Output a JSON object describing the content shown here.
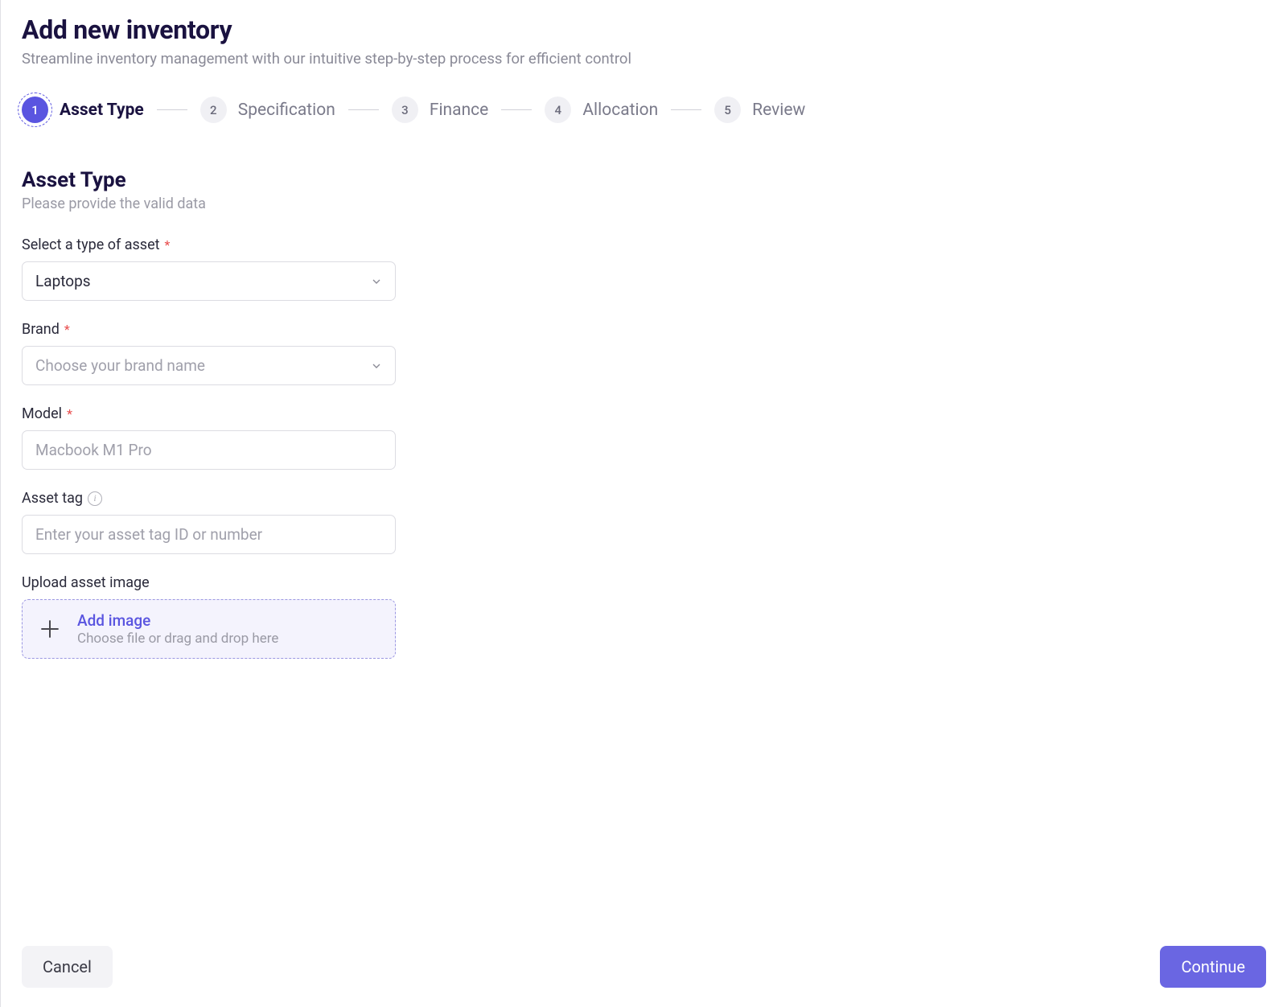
{
  "header": {
    "title": "Add new inventory",
    "subtitle": "Streamline inventory management with our intuitive step-by-step process for efficient control"
  },
  "stepper": {
    "steps": [
      {
        "num": "1",
        "label": "Asset Type",
        "active": true
      },
      {
        "num": "2",
        "label": "Specification",
        "active": false
      },
      {
        "num": "3",
        "label": "Finance",
        "active": false
      },
      {
        "num": "4",
        "label": "Allocation",
        "active": false
      },
      {
        "num": "5",
        "label": "Review",
        "active": false
      }
    ]
  },
  "section": {
    "title": "Asset Type",
    "subtitle": "Please provide the valid data"
  },
  "form": {
    "asset_type": {
      "label": "Select a type of asset",
      "value": "Laptops"
    },
    "brand": {
      "label": "Brand",
      "placeholder": "Choose your brand name"
    },
    "model": {
      "label": "Model",
      "placeholder": "Macbook M1 Pro"
    },
    "asset_tag": {
      "label": "Asset tag",
      "placeholder": "Enter your asset tag ID or number"
    },
    "upload": {
      "label": "Upload asset image",
      "title": "Add image",
      "sub": "Choose file or drag and drop here"
    }
  },
  "footer": {
    "cancel": "Cancel",
    "continue": "Continue"
  }
}
